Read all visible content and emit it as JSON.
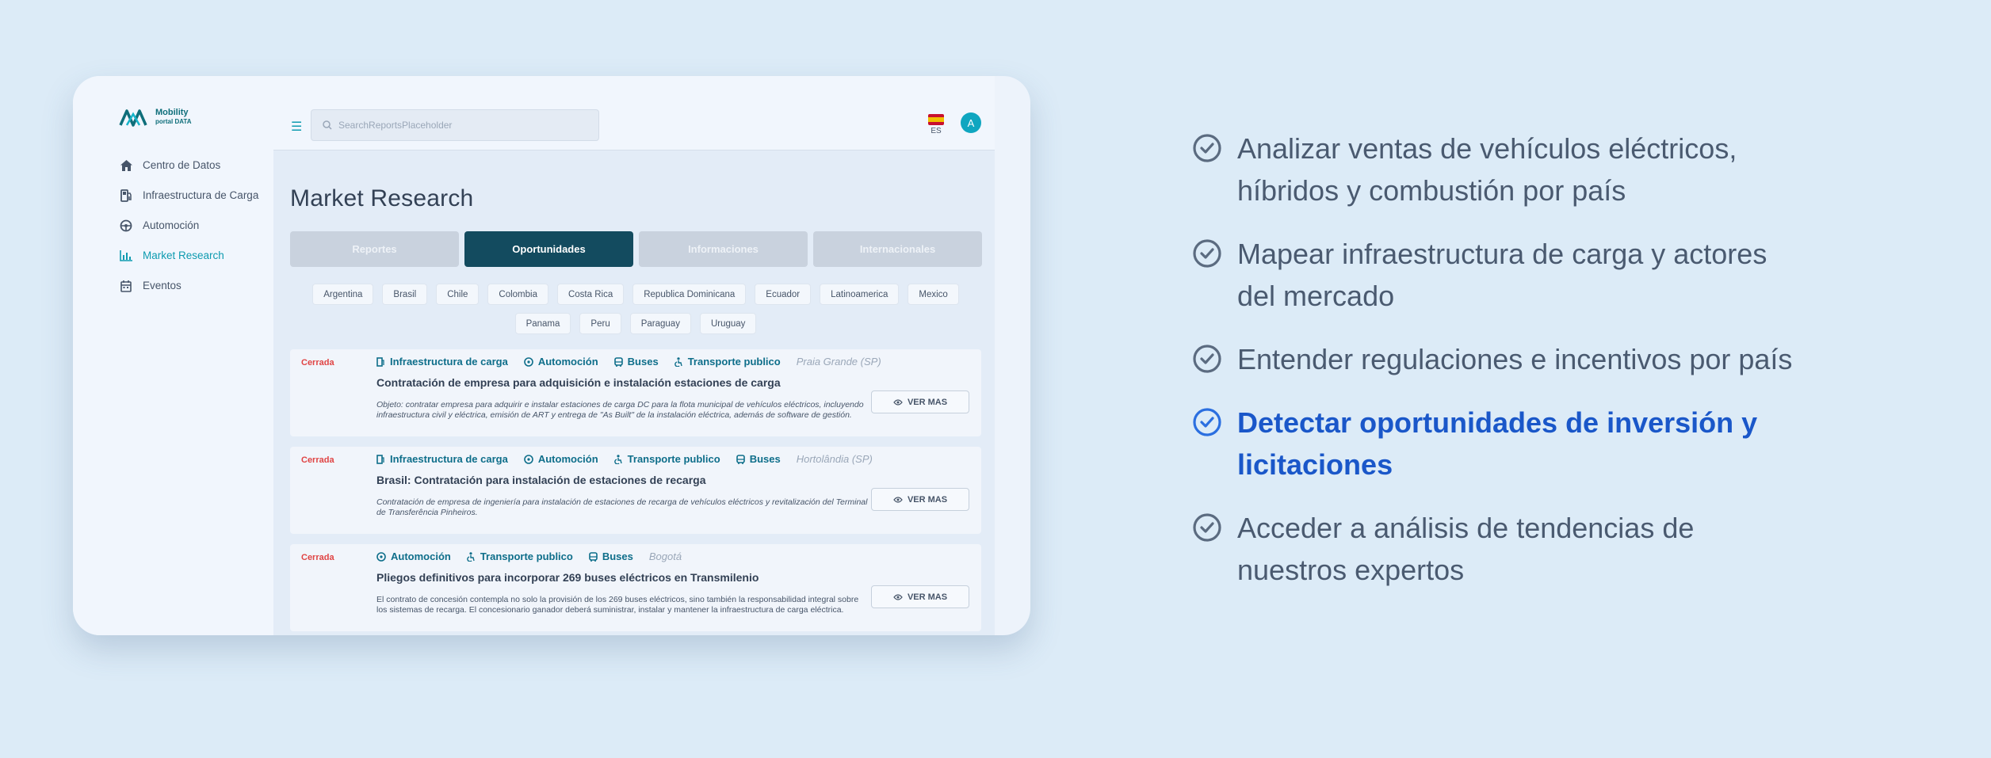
{
  "app": {
    "logo_text_1": "Mobility",
    "logo_text_2": "portal DATA"
  },
  "sidebar": {
    "items": [
      {
        "label": "Centro de Datos",
        "icon": "home-icon"
      },
      {
        "label": "Infraestructura de Carga",
        "icon": "fuel-station-icon"
      },
      {
        "label": "Automoción",
        "icon": "steering-wheel-icon"
      },
      {
        "label": "Market Research",
        "icon": "bar-chart-icon",
        "active": true
      },
      {
        "label": "Eventos",
        "icon": "calendar-icon"
      }
    ]
  },
  "topbar": {
    "search_placeholder": "SearchReportsPlaceholder",
    "language": "ES",
    "avatar_initial": "A"
  },
  "main": {
    "title": "Market Research",
    "tabs": [
      {
        "label": "Reportes"
      },
      {
        "label": "Oportunidades",
        "active": true
      },
      {
        "label": "Informaciones"
      },
      {
        "label": "Internacionales"
      }
    ],
    "countries": [
      "Argentina",
      "Brasil",
      "Chile",
      "Colombia",
      "Costa Rica",
      "Republica Dominicana",
      "Ecuador",
      "Latinoamerica",
      "Mexico",
      "Panama",
      "Peru",
      "Paraguay",
      "Uruguay"
    ],
    "results": [
      {
        "status": "Cerrada",
        "tags": [
          "Infraestructura de carga",
          "Automoción",
          "Buses",
          "Transporte publico"
        ],
        "location": "Praia Grande (SP)",
        "title": "Contratación de empresa para adquisición e instalación estaciones de carga",
        "description": "Objeto: contratar empresa para adquirir e instalar estaciones de carga DC para la flota municipal de vehículos eléctricos, incluyendo infraestructura civil y eléctrica, emisión de ART y entrega de \"As Built\" de la instalación eléctrica, además de software de gestión.",
        "button": "VER MAS"
      },
      {
        "status": "Cerrada",
        "tags": [
          "Infraestructura de carga",
          "Automoción",
          "Transporte publico",
          "Buses"
        ],
        "location": "Hortolândia (SP)",
        "title": "Brasil: Contratación para instalación de estaciones de recarga",
        "description": "Contratación de empresa de ingeniería para instalación de estaciones de recarga de vehículos eléctricos y revitalización del Terminal de Transferência Pinheiros.",
        "button": "VER MAS"
      },
      {
        "status": "Cerrada",
        "tags": [
          "Automoción",
          "Transporte publico",
          "Buses"
        ],
        "location": "Bogotá",
        "title": "Pliegos definitivos para incorporar 269 buses eléctricos en Transmilenio",
        "description": "El contrato de concesión contempla no solo la provisión de los 269 buses eléctricos, sino también la responsabilidad integral sobre los sistemas de recarga. El concesionario ganador deberá suministrar, instalar y mantener la infraestructura de carga eléctrica.",
        "button": "VER MAS"
      }
    ]
  },
  "features": [
    {
      "text": "Analizar ventas de vehículos eléctricos, híbridos y combustión por país",
      "highlight": false
    },
    {
      "text": "Mapear infraestructura de carga y actores del mercado",
      "highlight": false
    },
    {
      "text": "Entender regulaciones e incentivos por país",
      "highlight": false
    },
    {
      "text": "Detectar oportunidades de inversión y licitaciones",
      "highlight": true
    },
    {
      "text": "Acceder a análisis de tendencias de nuestros expertos",
      "highlight": false
    }
  ],
  "colors": {
    "accent": "#0e9bb0",
    "active_tab": "#134b5f",
    "status_closed": "#e04444",
    "highlight": "#1a57c9"
  }
}
